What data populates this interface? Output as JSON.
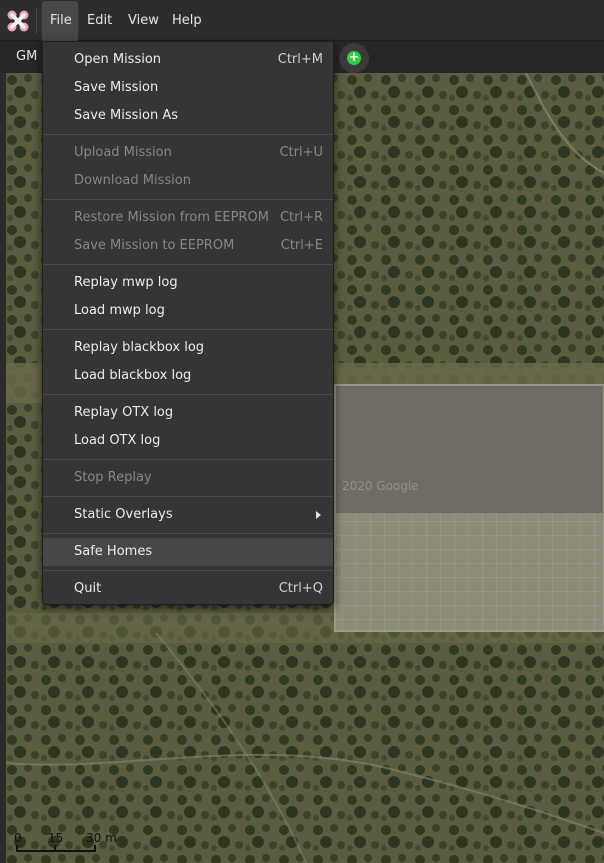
{
  "menubar": {
    "app_icon": "mwp-app-icon",
    "menus": [
      "File",
      "Edit",
      "View",
      "Help"
    ],
    "active_menu": "File"
  },
  "toolbar": {
    "map_source_label": "GM I",
    "add_icon": "plus-circle-icon",
    "add_color": "#2ecc40"
  },
  "map": {
    "watermark": "2020 Google",
    "scale_labels": [
      "0",
      "15",
      "30 m"
    ]
  },
  "file_menu": {
    "open_mission": {
      "label": "Open Mission",
      "accel": "Ctrl+M"
    },
    "save_mission": {
      "label": "Save Mission"
    },
    "save_mission_as": {
      "label": "Save Mission As"
    },
    "upload_mission": {
      "label": "Upload Mission",
      "accel": "Ctrl+U"
    },
    "download_mission": {
      "label": "Download Mission"
    },
    "restore_eeprom": {
      "label": "Restore Mission from EEPROM",
      "accel": "Ctrl+R"
    },
    "save_eeprom": {
      "label": "Save Mission to EEPROM",
      "accel": "Ctrl+E"
    },
    "replay_mwp": {
      "label": "Replay mwp log"
    },
    "load_mwp": {
      "label": "Load mwp log"
    },
    "replay_bbox": {
      "label": "Replay blackbox log"
    },
    "load_bbox": {
      "label": "Load blackbox log"
    },
    "replay_otx": {
      "label": "Replay OTX log"
    },
    "load_otx": {
      "label": "Load OTX log"
    },
    "stop_replay": {
      "label": "Stop Replay"
    },
    "static_overlays": {
      "label": "Static Overlays",
      "icon": "chevron-right-icon"
    },
    "safe_homes": {
      "label": "Safe Homes"
    },
    "quit": {
      "label": "Quit",
      "accel": "Ctrl+Q"
    }
  }
}
